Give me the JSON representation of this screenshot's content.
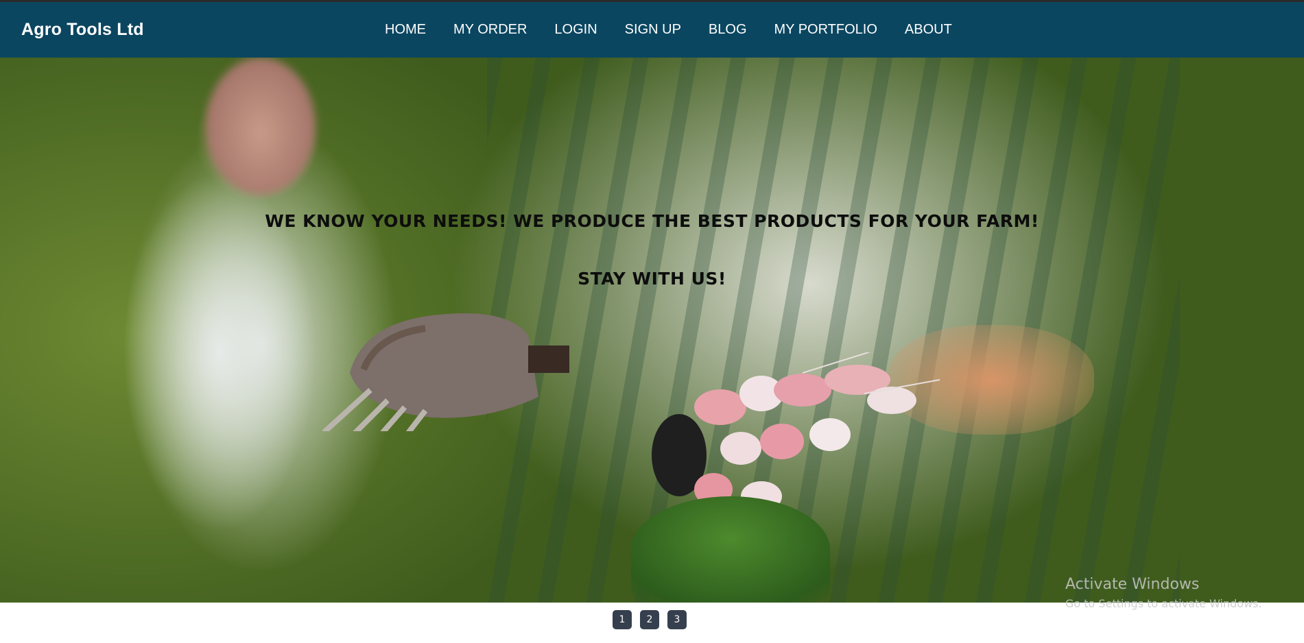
{
  "navbar": {
    "brand": "Agro Tools Ltd",
    "links": [
      "HOME",
      "MY ORDER",
      "LOGIN",
      "SIGN UP",
      "BLOG",
      "MY PORTFOLIO",
      "ABOUT"
    ],
    "background_color": "#0b4660"
  },
  "hero": {
    "headline": "WE KNOW YOUR NEEDS! WE PRODUCE THE BEST PRODUCTS FOR YOUR FARM!",
    "subline": "STAY WITH US!"
  },
  "carousel": {
    "pages": [
      "1",
      "2",
      "3"
    ]
  },
  "watermark": {
    "title": "Activate Windows",
    "subtitle": "Go to Settings to activate Windows."
  }
}
